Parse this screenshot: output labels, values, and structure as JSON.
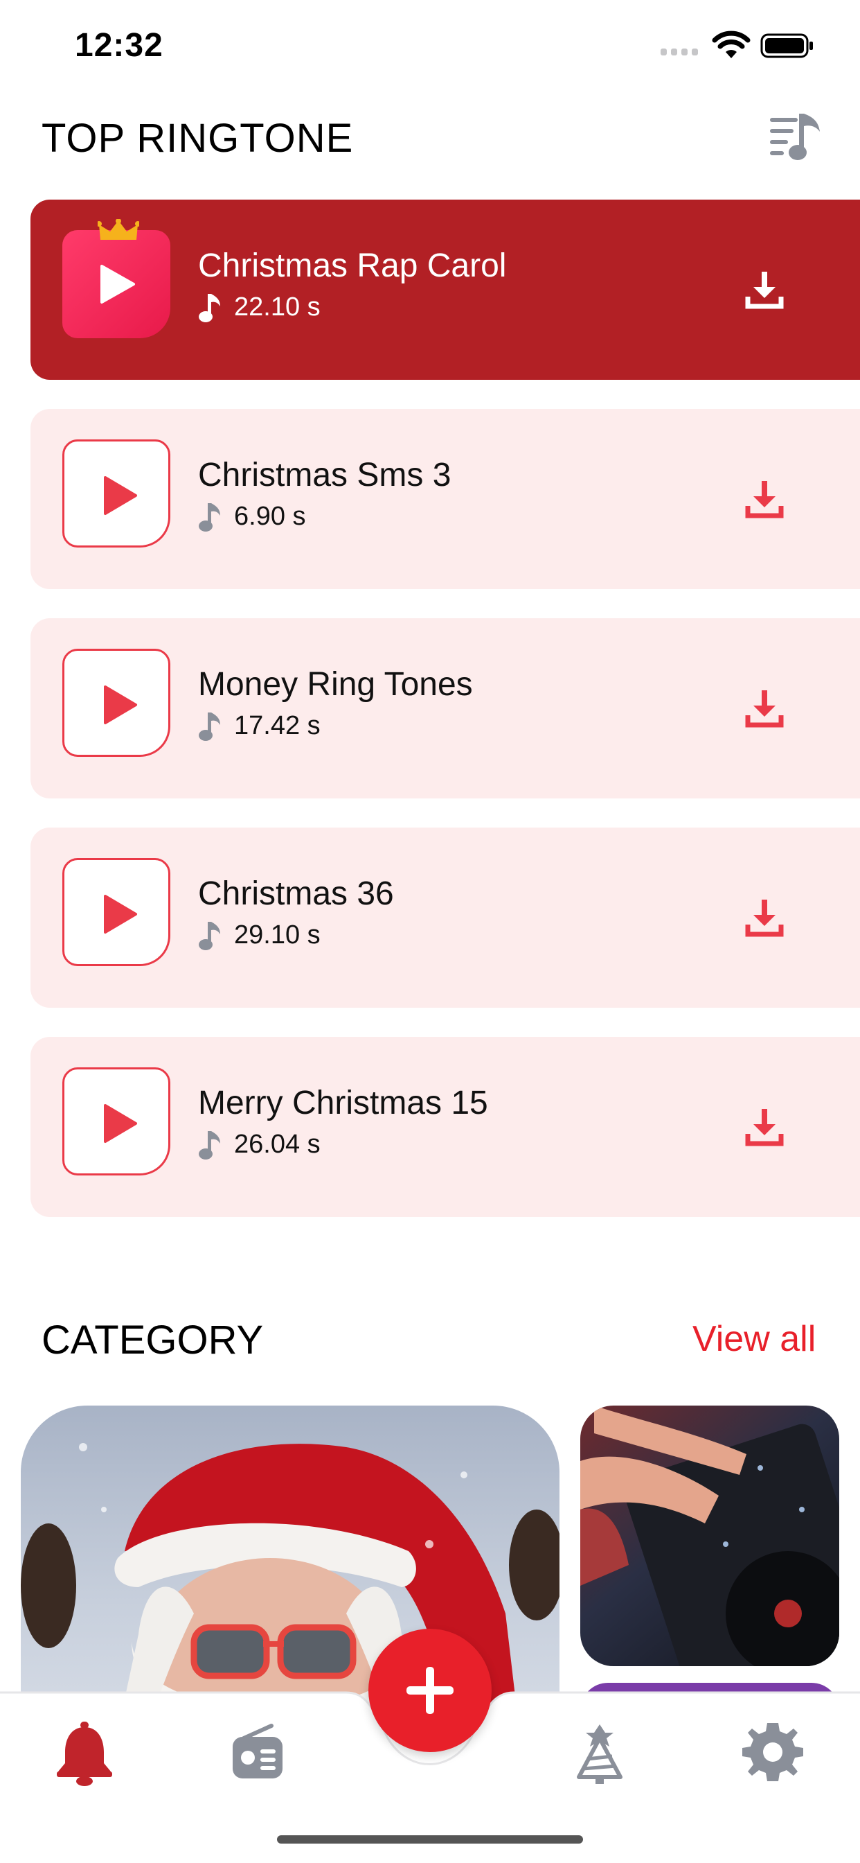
{
  "status_bar": {
    "time": "12:32"
  },
  "header": {
    "title": "TOP RINGTONE",
    "playlist_icon": "playlist-music-icon"
  },
  "ringtones": [
    {
      "title": "Christmas  Rap Carol",
      "duration": "22.10 s",
      "featured": true
    },
    {
      "title": "Christmas Sms 3",
      "duration": "6.90 s",
      "featured": false
    },
    {
      "title": "Money Ring Tones",
      "duration": "17.42 s",
      "featured": false
    },
    {
      "title": "Christmas 36",
      "duration": "29.10 s",
      "featured": false
    },
    {
      "title": "Merry Christmas 15",
      "duration": "26.04 s",
      "featured": false
    }
  ],
  "category": {
    "title": "CATEGORY",
    "view_all": "View all"
  },
  "tabs": [
    "bell-icon",
    "radio-icon",
    "add-icon",
    "christmas-tree-icon",
    "gear-icon"
  ],
  "colors": {
    "accent": "#e8202a",
    "featured": "#b22025",
    "card": "#fdecec",
    "tab_active": "#c0242b",
    "tab_inactive": "#8a8f99"
  }
}
